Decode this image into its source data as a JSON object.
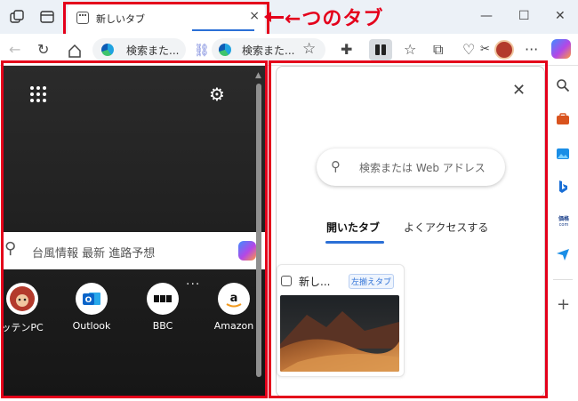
{
  "browser": {
    "tab": {
      "title": "新しいタブ",
      "close_glyph": "×"
    },
    "window_controls": {
      "minimize": "—",
      "maximize": "☐",
      "close": "✕"
    },
    "address_bar_1": {
      "text": "検索また..."
    },
    "address_bar_2": {
      "text": "検索また..."
    }
  },
  "annotation": {
    "label": "←つのタブ",
    "color": "#e4001b"
  },
  "new_tab_page": {
    "search_placeholder": "台風情報 最新 進路予想",
    "quick_links": [
      {
        "label": "ッテンPC",
        "icon": "rakuten-icon"
      },
      {
        "label": "Outlook",
        "icon": "outlook-icon"
      },
      {
        "label": "BBC",
        "icon": "bbc-icon"
      },
      {
        "label": "Amazon",
        "icon": "amazon-icon"
      }
    ],
    "more_glyph": "···"
  },
  "side_panel": {
    "close_glyph": "✕",
    "search_placeholder": "検索または Web アドレス",
    "tabs": [
      {
        "label": "開いたタブ",
        "active": true
      },
      {
        "label": "よくアクセスする",
        "active": false
      }
    ],
    "card": {
      "title": "新し...",
      "badge": "左揃えタブ"
    }
  },
  "colors": {
    "accent": "#2b6fd6",
    "annotation_red": "#e4001b"
  }
}
